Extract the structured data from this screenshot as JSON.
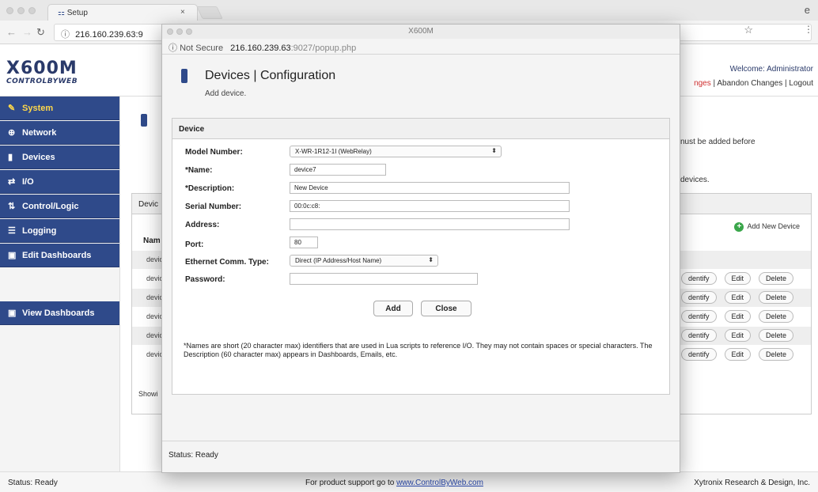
{
  "browser": {
    "tab_title": "Setup",
    "tab_icon": "network-icon",
    "tab_close": "×",
    "url": "216.160.239.63:9",
    "user_icon": "e"
  },
  "header": {
    "logo_main": "X600M",
    "logo_sub": "CONTROLBYWEB",
    "welcome": "Welcome: Administrator",
    "link_changes": "nges",
    "link_abandon": "Abandon Changes",
    "link_logout": "Logout",
    "separator": "|"
  },
  "sidebar": {
    "items": [
      {
        "label": "System",
        "icon": "wrench-icon"
      },
      {
        "label": "Network",
        "icon": "globe-icon"
      },
      {
        "label": "Devices",
        "icon": "device-icon"
      },
      {
        "label": "I/O",
        "icon": "arrows-icon"
      },
      {
        "label": "Control/Logic",
        "icon": "control-icon"
      },
      {
        "label": "Logging",
        "icon": "list-icon"
      },
      {
        "label": "Edit Dashboards",
        "icon": "dashboard-icon"
      },
      {
        "label": "View Dashboards",
        "icon": "dashboard-icon"
      }
    ]
  },
  "main": {
    "note1": "nust be added before",
    "note2": "devices.",
    "panel_title": "Devic",
    "add_device": "Add New Device",
    "col_name": "Nam",
    "rows": [
      "devic",
      "devic",
      "devic",
      "devic",
      "devic",
      "devic"
    ],
    "btn_identify": "dentify",
    "btn_edit": "Edit",
    "btn_delete": "Delete",
    "showing": "Showi"
  },
  "footer": {
    "status": "Status:  Ready",
    "support_text": "For product support go to",
    "support_link": "www.ControlByWeb.com",
    "company": "Xytronix Research & Design, Inc."
  },
  "popup": {
    "window_title": "X600M",
    "security": "Not Secure",
    "host": "216.160.239.63",
    "url_rest": ":9027/popup.php",
    "heading": "Devices | Configuration",
    "subheading": "Add device.",
    "section_title": "Device",
    "fields": {
      "model_label": "Model Number:",
      "model_value": "X-WR-1R12-1I (WebRelay)",
      "name_label": "*Name:",
      "name_value": "device7",
      "description_label": "*Description:",
      "description_value": "New Device",
      "serial_label": "Serial Number:",
      "serial_value": "00:0c:c8:",
      "address_label": "Address:",
      "address_value": "",
      "port_label": "Port:",
      "port_value": "80",
      "comm_label": "Ethernet Comm. Type:",
      "comm_value": "Direct (IP Address/Host Name)",
      "password_label": "Password:",
      "password_value": ""
    },
    "add_button": "Add",
    "close_button": "Close",
    "notes": "*Names are short (20 character max) identifiers that are used in Lua scripts to reference I/O. They may not contain spaces or special characters. The Description (60 character max) appears in Dashboards, Emails, etc.",
    "status": "Status:  Ready"
  }
}
